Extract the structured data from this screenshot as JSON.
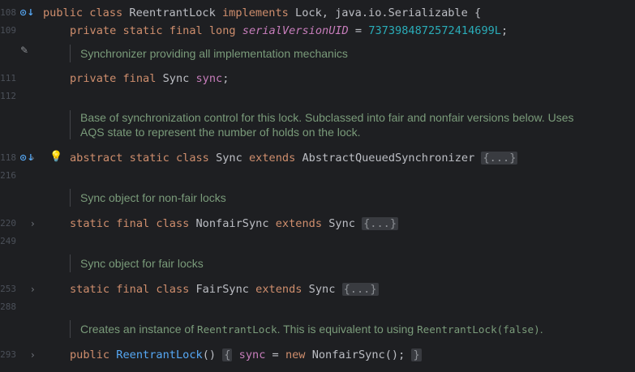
{
  "lines": {
    "l108": {
      "num": "108",
      "t1": "public class ",
      "t2": "ReentrantLock ",
      "t3": "implements ",
      "t4": "Lock, java.io.Serializable {"
    },
    "l109": {
      "num": "109",
      "t1": "private static final long ",
      "t2": "serialVersionUID",
      "t3": " = ",
      "t4": "7373984872572414699L",
      "t5": ";"
    },
    "l111": {
      "num": "111",
      "t1": "private final ",
      "t2": "Sync ",
      "t3": "sync",
      "t4": ";"
    },
    "l112": {
      "num": "112"
    },
    "l118": {
      "num": "118",
      "t1": "abstract static class ",
      "t2": "Sync ",
      "t3": "extends ",
      "t4": "AbstractQueuedSynchronizer ",
      "fold": "{...}"
    },
    "l216": {
      "num": "216"
    },
    "l220": {
      "num": "220",
      "t1": "static final class ",
      "t2": "NonfairSync ",
      "t3": "extends ",
      "t4": "Sync ",
      "fold": "{...}"
    },
    "l249": {
      "num": "249"
    },
    "l253": {
      "num": "253",
      "t1": "static final class ",
      "t2": "FairSync ",
      "t3": "extends ",
      "t4": "Sync ",
      "fold": "{...}"
    },
    "l288": {
      "num": "288"
    },
    "l293": {
      "num": "293",
      "t1": "public ",
      "t2": "ReentrantLock",
      "t3": "() ",
      "fold1": "{",
      "t4": " sync",
      "t5": " = ",
      "t6": "new ",
      "t7": "NonfairSync();",
      "fold2": "}"
    }
  },
  "docs": {
    "d1": "Synchronizer providing all implementation mechanics",
    "d2": "Base of synchronization control for this lock. Subclassed into fair and nonfair versions below. Uses AQS state to represent the number of holds on the lock.",
    "d3": "Sync object for non-fair locks",
    "d4": "Sync object for fair locks",
    "d5a": "Creates an instance of ",
    "d5b": "ReentrantLock",
    "d5c": ". This is equivalent to using ",
    "d5d": "ReentrantLock(false)",
    "d5e": "."
  },
  "icons": {
    "implemented": "implemented-by-icon",
    "fold": "chevron-right-icon",
    "bulb": "lightbulb-icon",
    "edit": "pencil-icon"
  },
  "colors": {
    "background": "#1e1f22",
    "keyword": "#cf8e6d",
    "field": "#c77dbb",
    "number": "#2aacb8",
    "method": "#56a8f5",
    "doc": "#7a9b7a"
  }
}
